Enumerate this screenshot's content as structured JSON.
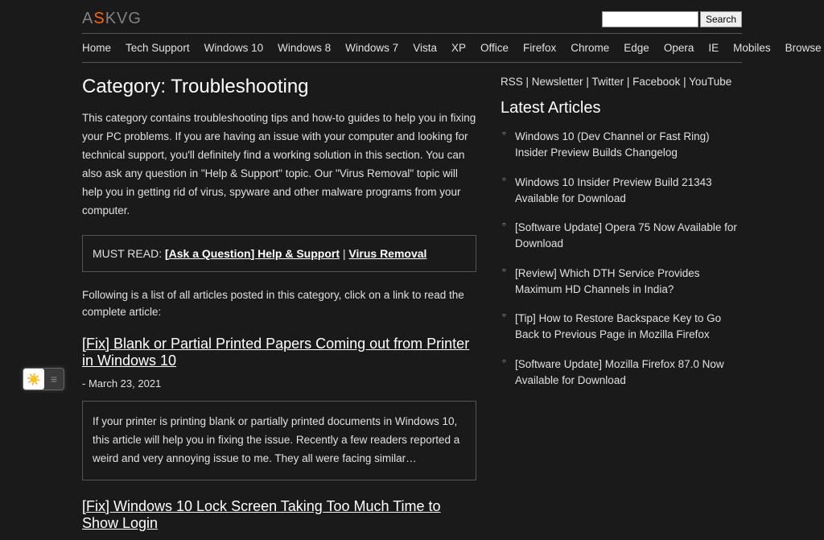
{
  "logo": {
    "left": "A",
    "mid": "S",
    "right": "KVG"
  },
  "search": {
    "placeholder": "",
    "btn": "Search"
  },
  "nav": [
    "Home",
    "Tech Support",
    "Windows 10",
    "Windows 8",
    "Windows 7",
    "Vista",
    "XP",
    "Office",
    "Firefox",
    "Chrome",
    "Edge",
    "Opera",
    "IE",
    "Mobiles",
    "Browse Categories"
  ],
  "category_title": "Category: Troubleshooting",
  "desc": "This category contains troubleshooting tips and how-to guides to help you in fixing your PC problems. If you are having an issue with your computer and looking for technical support, you'll definitely find a working solution in this section. You can also ask any question in \"Help & Support\" topic. Our \"Virus Removal\" topic will help you in getting rid of virus, spyware and other malware programs from your computer.",
  "must_read": {
    "label": "MUST READ: ",
    "link1": "[Ask a Question] Help & Support",
    "sep": " | ",
    "link2": "Virus Removal"
  },
  "following": "Following is a list of all articles posted in this category, click on a link to read the complete article:",
  "articles": [
    {
      "title": "[Fix] Blank or Partial Printed Papers Coming out from Printer in Windows 10",
      "date": "- March 23, 2021",
      "excerpt": "If your printer is printing blank or partially printed documents in Windows 10, this article will help you in fixing the issue. Recently a few readers reported a weird and very annoying issue to me. They all were facing similar…"
    },
    {
      "title": "[Fix] Windows 10 Lock Screen Taking Too Much Time to Show Login",
      "date": "",
      "excerpt": ""
    }
  ],
  "feeds": [
    "RSS",
    "Newsletter",
    "Twitter",
    "Facebook",
    "YouTube"
  ],
  "feeds_sep": " | ",
  "latest_heading": "Latest Articles",
  "latest": [
    "Windows 10 (Dev Channel or Fast Ring) Insider Preview Builds Changelog",
    "Windows 10 Insider Preview Build 21343 Available for Download",
    "[Software Update] Opera 75 Now Available for Download",
    "[Review] Which DTH Service Provides Maximum HD Channels in India?",
    "[Tip] How to Restore Backspace Key to Go Back to Previous Page in Mozilla Firefox",
    "[Software Update] Mozilla Firefox 87.0 Now Available for Download"
  ]
}
